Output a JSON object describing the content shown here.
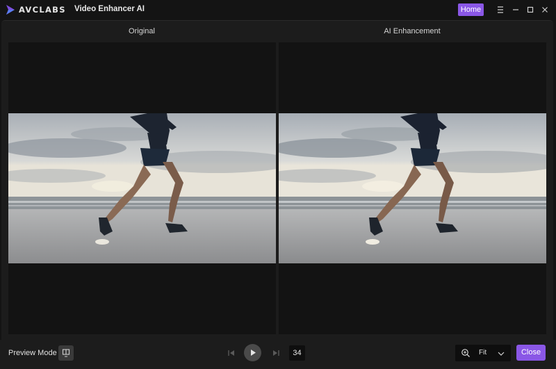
{
  "titlebar": {
    "brand": "AVCLABS",
    "app_title": "Video Enhancer AI",
    "home_label": "Home",
    "icons": [
      "avclabs-logo-icon",
      "menu-icon",
      "minimize-icon",
      "maximize-icon",
      "close-window-icon"
    ]
  },
  "panes": {
    "left_label": "Original",
    "right_label": "AI Enhancement"
  },
  "bottombar": {
    "preview_mode_label": "Preview Mode",
    "frame_number": "34",
    "zoom_value": "Fit",
    "close_label": "Close",
    "icons": [
      "preview-mode-icon",
      "skip-back-icon",
      "play-icon",
      "skip-forward-icon",
      "zoom-in-icon",
      "chevron-down-icon"
    ]
  },
  "colors": {
    "accent": "#8a57e6",
    "background": "#141414",
    "panel": "#1c1c1c"
  }
}
